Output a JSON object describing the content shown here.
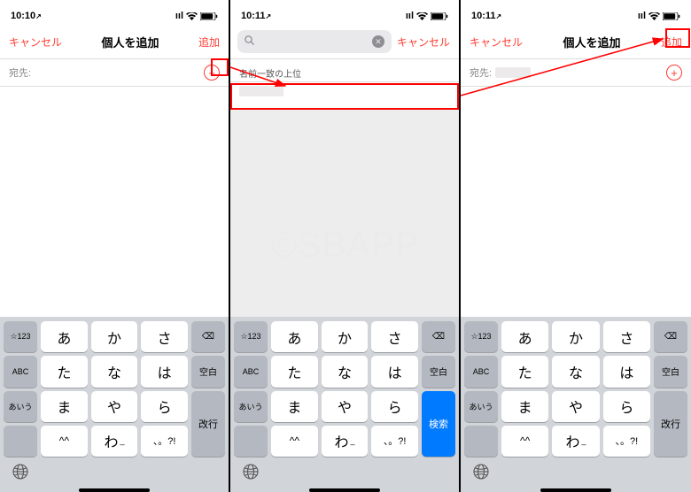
{
  "watermark": "©SBAPP",
  "colors": {
    "accent": "#ff3b30",
    "blue": "#007aff"
  },
  "status": {
    "time_a": "10:10",
    "time_b": "10:11",
    "time_c": "10:11",
    "loc": "↗",
    "signal": "ııl",
    "wifi": "⌃",
    "battery": "■"
  },
  "nav": {
    "cancel": "キャンセル",
    "title": "個人を追加",
    "add": "追加"
  },
  "to_label": "宛先:",
  "search": {
    "placeholder": ""
  },
  "section_header": "名前一致の上位",
  "keyboard": {
    "side_left": [
      "☆123",
      "ABC",
      "あいう",
      ""
    ],
    "kana": [
      [
        "あ",
        "か",
        "さ"
      ],
      [
        "た",
        "な",
        "は"
      ],
      [
        "ま",
        "や",
        "ら"
      ],
      [
        "^^",
        "わ",
        "、。?!"
      ]
    ],
    "side_right": {
      "del": "⌫",
      "space": "空白",
      "enter": "改行",
      "search": "検索"
    },
    "globe": "⊕"
  },
  "highlights": {
    "plus_button": true,
    "suggestion_row": true,
    "add_button": true
  }
}
